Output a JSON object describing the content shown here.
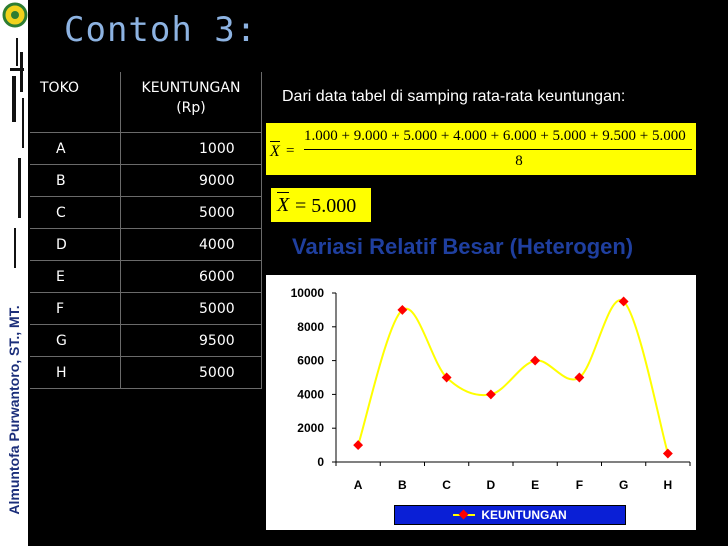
{
  "header": {
    "title": "Contoh 3:"
  },
  "author": "Almuntofa Purwantoro, ST., MT.",
  "table": {
    "headers": [
      "TOKO",
      "KEUNTUNGAN",
      "(Rp)"
    ],
    "rows": [
      {
        "toko": "A",
        "keuntungan": "1000"
      },
      {
        "toko": "B",
        "keuntungan": "9000"
      },
      {
        "toko": "C",
        "keuntungan": "5000"
      },
      {
        "toko": "D",
        "keuntungan": "4000"
      },
      {
        "toko": "E",
        "keuntungan": "6000"
      },
      {
        "toko": "F",
        "keuntungan": "5000"
      },
      {
        "toko": "G",
        "keuntungan": "9500"
      },
      {
        "toko": "H",
        "keuntungan": "5000"
      }
    ]
  },
  "description": "Dari data tabel di samping rata-rata  keuntungan:",
  "formula": {
    "xbar": "X",
    "eq": "=",
    "numerator": "1.000 + 9.000 + 5.000 + 4.000 + 6.000 + 5.000 + 9.500 + 5.000",
    "denominator": "8",
    "result": "= 5.000"
  },
  "colors": {
    "title": "#8db3e2",
    "formula_bg": "#ffff00",
    "chart_title": "#1f3f9f",
    "line": "#ffff00",
    "marker": "#ff0000",
    "legend_bg": "#0a1fd6"
  },
  "chart_data": {
    "type": "line",
    "title": "Variasi Relatif Besar (Heterogen)",
    "categories": [
      "A",
      "B",
      "C",
      "D",
      "E",
      "F",
      "G",
      "H"
    ],
    "series": [
      {
        "name": "KEUNTUNGAN",
        "values": [
          1000,
          9000,
          5000,
          4000,
          6000,
          5000,
          9500,
          500
        ]
      }
    ],
    "ylim": [
      0,
      10000
    ],
    "yticks": [
      "0",
      "2000",
      "4000",
      "6000",
      "8000",
      "10000"
    ],
    "smooth": true,
    "grid": false,
    "legend": "bottom"
  }
}
